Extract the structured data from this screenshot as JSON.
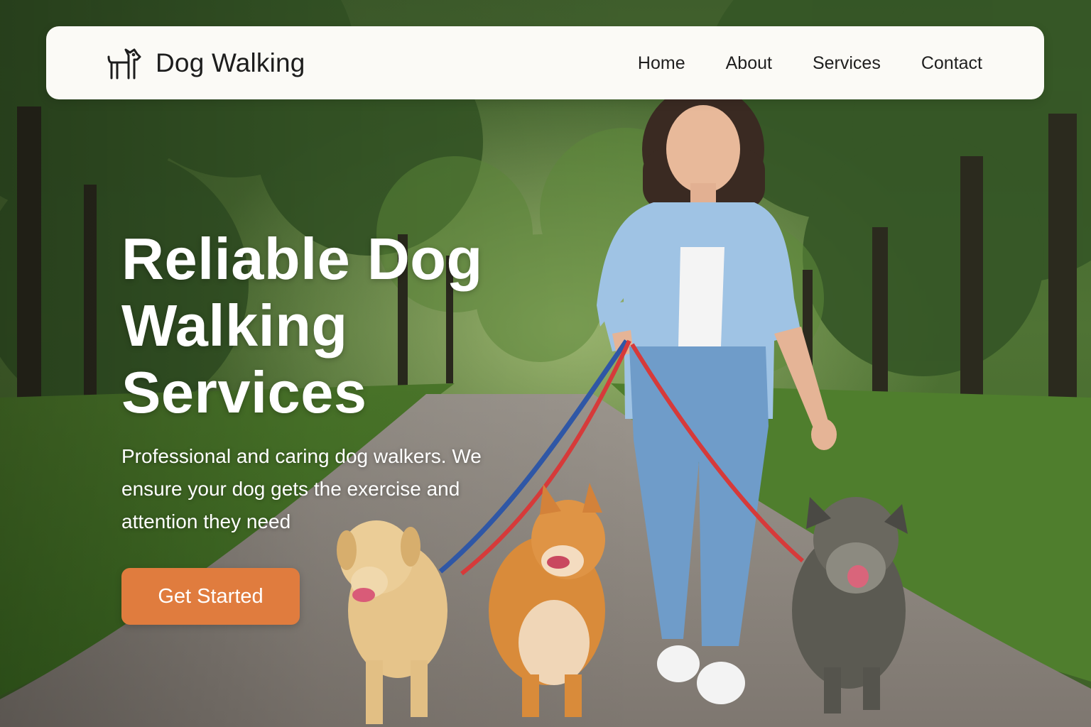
{
  "brand": {
    "name": "Dog Walking",
    "icon": "dog-icon"
  },
  "nav": {
    "items": [
      {
        "label": "Home"
      },
      {
        "label": "About"
      },
      {
        "label": "Services"
      },
      {
        "label": "Contact"
      }
    ]
  },
  "hero": {
    "title_lines": [
      "Reliable Dog",
      "Walking",
      "Services"
    ],
    "subtitle": "Professional and caring dog walkers. We ensure your dog gets the exercise and attention they need",
    "cta_label": "Get Started",
    "image": "woman-walking-three-dogs-photo"
  },
  "colors": {
    "accent": "#e07c3e",
    "navbar_bg": "#fbfaf6",
    "text_dark": "#1d1d1d",
    "hero_text": "#ffffff"
  }
}
